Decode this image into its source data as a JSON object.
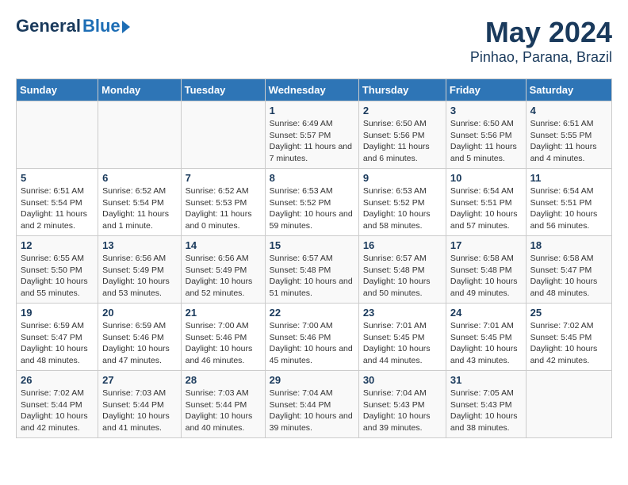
{
  "logo": {
    "general": "General",
    "blue": "Blue"
  },
  "title": "May 2024",
  "subtitle": "Pinhao, Parana, Brazil",
  "days_of_week": [
    "Sunday",
    "Monday",
    "Tuesday",
    "Wednesday",
    "Thursday",
    "Friday",
    "Saturday"
  ],
  "weeks": [
    [
      {
        "day": "",
        "text": ""
      },
      {
        "day": "",
        "text": ""
      },
      {
        "day": "",
        "text": ""
      },
      {
        "day": "1",
        "text": "Sunrise: 6:49 AM\nSunset: 5:57 PM\nDaylight: 11 hours and 7 minutes."
      },
      {
        "day": "2",
        "text": "Sunrise: 6:50 AM\nSunset: 5:56 PM\nDaylight: 11 hours and 6 minutes."
      },
      {
        "day": "3",
        "text": "Sunrise: 6:50 AM\nSunset: 5:56 PM\nDaylight: 11 hours and 5 minutes."
      },
      {
        "day": "4",
        "text": "Sunrise: 6:51 AM\nSunset: 5:55 PM\nDaylight: 11 hours and 4 minutes."
      }
    ],
    [
      {
        "day": "5",
        "text": "Sunrise: 6:51 AM\nSunset: 5:54 PM\nDaylight: 11 hours and 2 minutes."
      },
      {
        "day": "6",
        "text": "Sunrise: 6:52 AM\nSunset: 5:54 PM\nDaylight: 11 hours and 1 minute."
      },
      {
        "day": "7",
        "text": "Sunrise: 6:52 AM\nSunset: 5:53 PM\nDaylight: 11 hours and 0 minutes."
      },
      {
        "day": "8",
        "text": "Sunrise: 6:53 AM\nSunset: 5:52 PM\nDaylight: 10 hours and 59 minutes."
      },
      {
        "day": "9",
        "text": "Sunrise: 6:53 AM\nSunset: 5:52 PM\nDaylight: 10 hours and 58 minutes."
      },
      {
        "day": "10",
        "text": "Sunrise: 6:54 AM\nSunset: 5:51 PM\nDaylight: 10 hours and 57 minutes."
      },
      {
        "day": "11",
        "text": "Sunrise: 6:54 AM\nSunset: 5:51 PM\nDaylight: 10 hours and 56 minutes."
      }
    ],
    [
      {
        "day": "12",
        "text": "Sunrise: 6:55 AM\nSunset: 5:50 PM\nDaylight: 10 hours and 55 minutes."
      },
      {
        "day": "13",
        "text": "Sunrise: 6:56 AM\nSunset: 5:49 PM\nDaylight: 10 hours and 53 minutes."
      },
      {
        "day": "14",
        "text": "Sunrise: 6:56 AM\nSunset: 5:49 PM\nDaylight: 10 hours and 52 minutes."
      },
      {
        "day": "15",
        "text": "Sunrise: 6:57 AM\nSunset: 5:48 PM\nDaylight: 10 hours and 51 minutes."
      },
      {
        "day": "16",
        "text": "Sunrise: 6:57 AM\nSunset: 5:48 PM\nDaylight: 10 hours and 50 minutes."
      },
      {
        "day": "17",
        "text": "Sunrise: 6:58 AM\nSunset: 5:48 PM\nDaylight: 10 hours and 49 minutes."
      },
      {
        "day": "18",
        "text": "Sunrise: 6:58 AM\nSunset: 5:47 PM\nDaylight: 10 hours and 48 minutes."
      }
    ],
    [
      {
        "day": "19",
        "text": "Sunrise: 6:59 AM\nSunset: 5:47 PM\nDaylight: 10 hours and 48 minutes."
      },
      {
        "day": "20",
        "text": "Sunrise: 6:59 AM\nSunset: 5:46 PM\nDaylight: 10 hours and 47 minutes."
      },
      {
        "day": "21",
        "text": "Sunrise: 7:00 AM\nSunset: 5:46 PM\nDaylight: 10 hours and 46 minutes."
      },
      {
        "day": "22",
        "text": "Sunrise: 7:00 AM\nSunset: 5:46 PM\nDaylight: 10 hours and 45 minutes."
      },
      {
        "day": "23",
        "text": "Sunrise: 7:01 AM\nSunset: 5:45 PM\nDaylight: 10 hours and 44 minutes."
      },
      {
        "day": "24",
        "text": "Sunrise: 7:01 AM\nSunset: 5:45 PM\nDaylight: 10 hours and 43 minutes."
      },
      {
        "day": "25",
        "text": "Sunrise: 7:02 AM\nSunset: 5:45 PM\nDaylight: 10 hours and 42 minutes."
      }
    ],
    [
      {
        "day": "26",
        "text": "Sunrise: 7:02 AM\nSunset: 5:44 PM\nDaylight: 10 hours and 42 minutes."
      },
      {
        "day": "27",
        "text": "Sunrise: 7:03 AM\nSunset: 5:44 PM\nDaylight: 10 hours and 41 minutes."
      },
      {
        "day": "28",
        "text": "Sunrise: 7:03 AM\nSunset: 5:44 PM\nDaylight: 10 hours and 40 minutes."
      },
      {
        "day": "29",
        "text": "Sunrise: 7:04 AM\nSunset: 5:44 PM\nDaylight: 10 hours and 39 minutes."
      },
      {
        "day": "30",
        "text": "Sunrise: 7:04 AM\nSunset: 5:43 PM\nDaylight: 10 hours and 39 minutes."
      },
      {
        "day": "31",
        "text": "Sunrise: 7:05 AM\nSunset: 5:43 PM\nDaylight: 10 hours and 38 minutes."
      },
      {
        "day": "",
        "text": ""
      }
    ]
  ]
}
